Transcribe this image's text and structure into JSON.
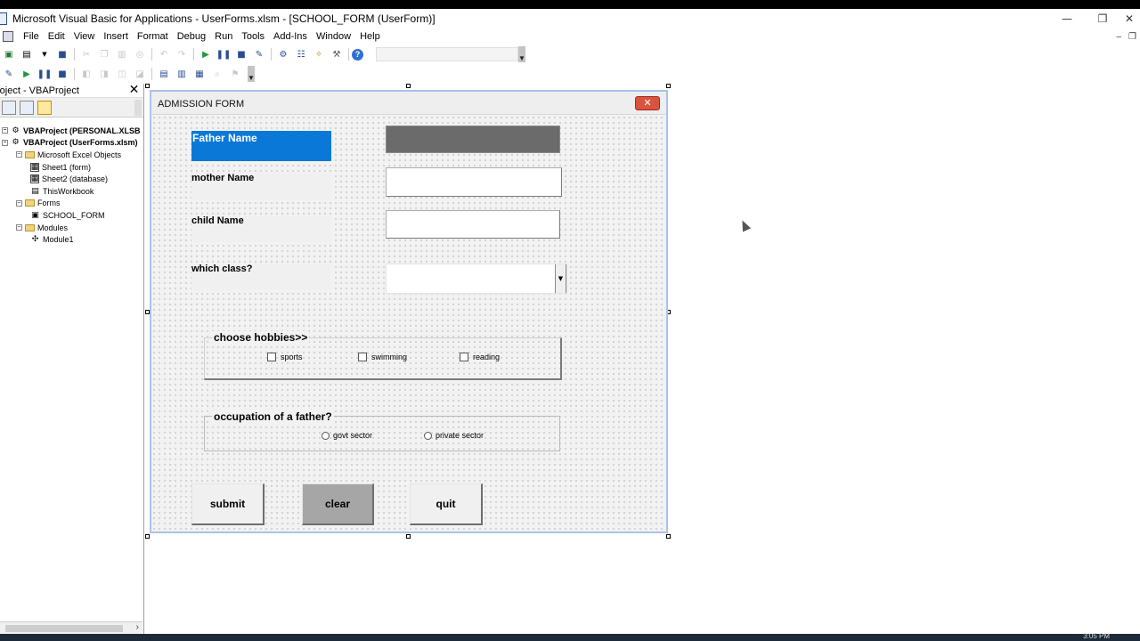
{
  "window": {
    "title": "Microsoft Visual Basic for Applications - UserForms.xlsm - [SCHOOL_FORM (UserForm)]",
    "minimize": "—",
    "restore": "❐",
    "close": "✕"
  },
  "menu": {
    "items": [
      "File",
      "Edit",
      "View",
      "Insert",
      "Format",
      "Debug",
      "Run",
      "Tools",
      "Add-Ins",
      "Window",
      "Help"
    ],
    "mdi_minimize": "–",
    "mdi_restore": "❐"
  },
  "project": {
    "title": "roject - VBAProject",
    "close": "✕",
    "tree": [
      {
        "text": "VBAProject (PERSONAL.XLSB",
        "bold": true,
        "indent": 0,
        "icon": "vba-project-icon"
      },
      {
        "text": "VBAProject (UserForms.xlsm)",
        "bold": true,
        "indent": 0,
        "icon": "vba-project-icon"
      },
      {
        "text": "Microsoft Excel Objects",
        "bold": false,
        "indent": 1,
        "icon": "folder-icon"
      },
      {
        "text": "Sheet1 (form)",
        "bold": false,
        "indent": 2,
        "icon": "sheet-icon"
      },
      {
        "text": "Sheet2 (database)",
        "bold": false,
        "indent": 2,
        "icon": "sheet-icon"
      },
      {
        "text": "ThisWorkbook",
        "bold": false,
        "indent": 2,
        "icon": "workbook-icon"
      },
      {
        "text": "Forms",
        "bold": false,
        "indent": 1,
        "icon": "folder-icon"
      },
      {
        "text": "SCHOOL_FORM",
        "bold": false,
        "indent": 2,
        "icon": "form-icon"
      },
      {
        "text": "Modules",
        "bold": false,
        "indent": 1,
        "icon": "folder-icon"
      },
      {
        "text": "Module1",
        "bold": false,
        "indent": 2,
        "icon": "module-icon"
      }
    ]
  },
  "form": {
    "caption": "ADMISSION FORM",
    "close": "✕",
    "labels": {
      "father": "Father Name",
      "mother": "mother Name",
      "child": "child Name",
      "class": "which class?"
    },
    "hobbies": {
      "caption": "choose hobbies>>",
      "options": [
        "sports",
        "swimming",
        "reading"
      ]
    },
    "occupation": {
      "caption": "occupation of a father?",
      "options": [
        "govt sector",
        "private sector"
      ]
    },
    "buttons": {
      "submit": "submit",
      "clear": "clear",
      "quit": "quit"
    }
  },
  "taskbar": {
    "clock": "3:05 PM"
  },
  "colors": {
    "selection": "#0a78d7",
    "form_border": "#a9c3e8",
    "close_red": "#d9533f"
  }
}
